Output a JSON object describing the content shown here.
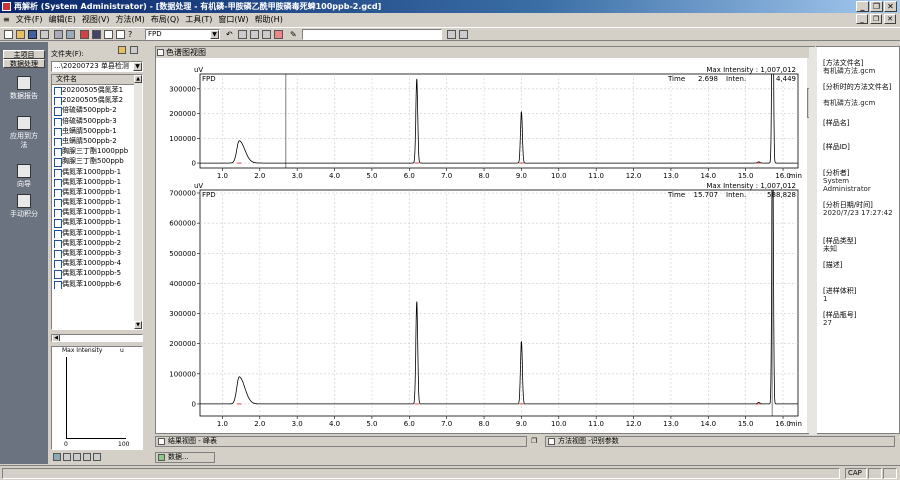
{
  "window": {
    "title": "再解析 (System Administrator) - [数据处理 - 有机磷-甲胺磷乙酰甲胺磷毒死蜱100ppb-2.gcd]"
  },
  "menu": [
    "文件(F)",
    "编辑(E)",
    "视图(V)",
    "方法(M)",
    "布局(Q)",
    "工具(T)",
    "窗口(W)",
    "帮助(H)"
  ],
  "toolbar": {
    "detector_select": "FPD"
  },
  "leftbar": {
    "tab1": "主项目",
    "tab2": "数据处理",
    "nav": [
      "数据报告",
      "应用到方法",
      "向导",
      "手动积分"
    ]
  },
  "filepanel": {
    "label": "文件夹(F):",
    "folder": "...\\20200723 单县检测",
    "column_header": "文件名",
    "files": [
      "20200505偶氮苯1",
      "20200505偶氮苯2",
      "倍硫磷500ppb-2",
      "倍硫磷500ppb-3",
      "虫螨腈500ppb-1",
      "虫螨腈500ppb-2",
      "胸腺三丁酯1000ppb",
      "胸腺三丁酯500ppb",
      "偶氮苯1000ppb-1",
      "偶氮苯1000ppb-1",
      "偶氮苯1000ppb-1",
      "偶氮苯1000ppb-1",
      "偶氮苯1000ppb-1",
      "偶氮苯1000ppb-1",
      "偶氮苯1000ppb-1",
      "偶氮苯1000ppb-2",
      "偶氮苯1000ppb-3",
      "偶氮苯1000ppb-4",
      "偶氮苯1000ppb-5",
      "偶氮苯1000ppb-6"
    ],
    "preview_title": "Max Intensity",
    "preview_unit": "u",
    "preview_x": [
      "0",
      "100"
    ]
  },
  "chromatogram_window": {
    "title": "色谱图视图"
  },
  "chart_data": [
    {
      "type": "line",
      "detector": "FPD",
      "ylabel": "uV",
      "xlabel": "min",
      "xlim": [
        0.4,
        16.4
      ],
      "ylim": [
        -20000,
        360000
      ],
      "yticks": [
        0,
        100000,
        200000,
        300000
      ],
      "ytick_labels": [
        "0",
        "100000",
        "200000",
        "300000"
      ],
      "xticks": [
        1.0,
        2.0,
        3.0,
        4.0,
        5.0,
        6.0,
        7.0,
        8.0,
        9.0,
        10.0,
        11.0,
        12.0,
        13.0,
        14.0,
        15.0,
        16.0
      ],
      "xtick_labels": [
        "1.0",
        "2.0",
        "3.0",
        "4.0",
        "5.0",
        "6.0",
        "7.0",
        "8.0",
        "9.0",
        "10.0",
        "11.0",
        "12.0",
        "13.0",
        "14.0",
        "15.0",
        "16.0"
      ],
      "max_intensity_label": "Max Intensity : 1,007,012",
      "cursor_time_label": "Time",
      "cursor_time": "2.698",
      "cursor_inten_label": "Inten.",
      "cursor_inten": "4,449",
      "peaks": [
        {
          "rt": 1.45,
          "height": 90000,
          "width": 0.12
        },
        {
          "rt": 6.2,
          "height": 340000,
          "width": 0.025
        },
        {
          "rt": 9.0,
          "height": 208000,
          "width": 0.025
        },
        {
          "rt": 15.35,
          "height": 5000,
          "width": 0.03
        },
        {
          "rt": 15.72,
          "height": 1007012,
          "width": 0.02
        }
      ]
    },
    {
      "type": "line",
      "detector": "FPD",
      "ylabel": "uV",
      "xlabel": "min",
      "xlim": [
        0.4,
        16.4
      ],
      "ylim": [
        -40000,
        710000
      ],
      "yticks": [
        0,
        100000,
        200000,
        300000,
        400000,
        500000,
        600000,
        700000
      ],
      "ytick_labels": [
        "0",
        "100000",
        "200000",
        "300000",
        "400000",
        "500000",
        "600000",
        "700000"
      ],
      "xticks": [
        1.0,
        2.0,
        3.0,
        4.0,
        5.0,
        6.0,
        7.0,
        8.0,
        9.0,
        10.0,
        11.0,
        12.0,
        13.0,
        14.0,
        15.0,
        16.0
      ],
      "xtick_labels": [
        "1.0",
        "2.0",
        "3.0",
        "4.0",
        "5.0",
        "6.0",
        "7.0",
        "8.0",
        "9.0",
        "10.0",
        "11.0",
        "12.0",
        "13.0",
        "14.0",
        "15.0",
        "16.0"
      ],
      "max_intensity_label": "Max Intensity : 1,007,012",
      "cursor_time_label": "Time",
      "cursor_time": "15.707",
      "cursor_inten_label": "Inten.",
      "cursor_inten": "588,828",
      "peaks": [
        {
          "rt": 1.45,
          "height": 90000,
          "width": 0.12
        },
        {
          "rt": 6.2,
          "height": 340000,
          "width": 0.025
        },
        {
          "rt": 9.0,
          "height": 208000,
          "width": 0.025
        },
        {
          "rt": 15.35,
          "height": 5000,
          "width": 0.03
        },
        {
          "rt": 15.72,
          "height": 1007012,
          "width": 0.02
        }
      ]
    }
  ],
  "info": [
    {
      "label": "[方法文件名]",
      "value": "有机磷方法.gcm"
    },
    {
      "label": "[分析时的方法文件名]",
      "value": "有机磷方法.gcm"
    },
    {
      "label": "[样品名]",
      "value": ""
    },
    {
      "label": "[样品ID]",
      "value": ""
    },
    {
      "label": "[分析者]",
      "value": "System Administrator"
    },
    {
      "label": "[分析日期/时间]",
      "value": "2020/7/23 17:27:42"
    },
    {
      "label": "[样品类型]",
      "value": "未知"
    },
    {
      "label": "[描述]",
      "value": ""
    },
    {
      "label": "[进样体积]",
      "value": "1"
    },
    {
      "label": "[样品瓶号]",
      "value": "27"
    }
  ],
  "bottom_tabs": {
    "results": "结果视图 - 峰表",
    "method": "方法视图 -识别参数",
    "data_tab": "数据..."
  },
  "status": {
    "cap": "CAP"
  }
}
